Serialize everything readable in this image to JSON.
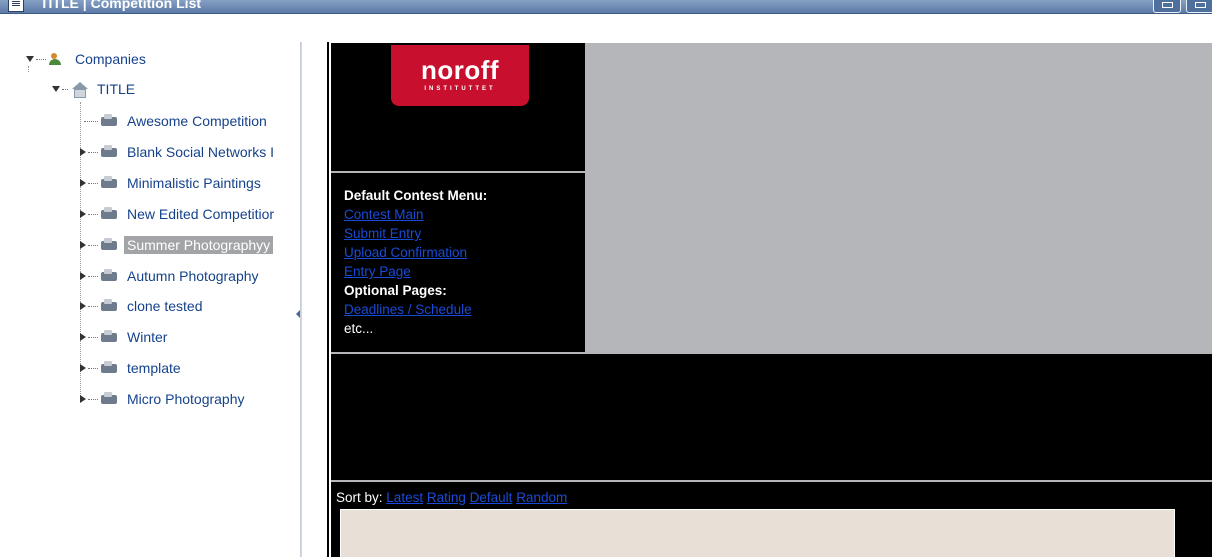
{
  "window": {
    "title": "TITLE | Competition List"
  },
  "tree": {
    "root": "Companies",
    "company": "TITLE",
    "items": [
      {
        "label": "Awesome Competition",
        "expandable": false,
        "selected": false
      },
      {
        "label": "Blank Social Networks I",
        "expandable": true,
        "selected": false
      },
      {
        "label": "Minimalistic Paintings",
        "expandable": true,
        "selected": false
      },
      {
        "label": "New Edited Competitior",
        "expandable": true,
        "selected": false
      },
      {
        "label": "Summer Photographyy",
        "expandable": true,
        "selected": true
      },
      {
        "label": "Autumn Photography",
        "expandable": true,
        "selected": false
      },
      {
        "label": "clone tested",
        "expandable": true,
        "selected": false
      },
      {
        "label": "Winter",
        "expandable": true,
        "selected": false
      },
      {
        "label": "template",
        "expandable": true,
        "selected": false
      },
      {
        "label": "Micro Photography",
        "expandable": true,
        "selected": false
      }
    ]
  },
  "preview": {
    "logo": {
      "name": "noroff",
      "sub": "INSTITUTTET",
      "color": "#c8102e"
    },
    "menu": {
      "heading": "Default Contest Menu:",
      "links": [
        "Contest Main",
        "Submit Entry",
        "Upload Confirmation",
        "Entry Page"
      ],
      "optional_heading": "Optional Pages:",
      "optional_links": [
        "Deadlines / Schedule"
      ],
      "etc": "etc..."
    },
    "sort": {
      "label": "Sort by:",
      "options": [
        "Latest",
        "Rating",
        "Default",
        "Random"
      ]
    }
  },
  "colors": {
    "link": "#1a4bd6",
    "tree_text": "#15428b",
    "selection": "#a2a4a8",
    "header_grey": "#b5b6ba"
  }
}
